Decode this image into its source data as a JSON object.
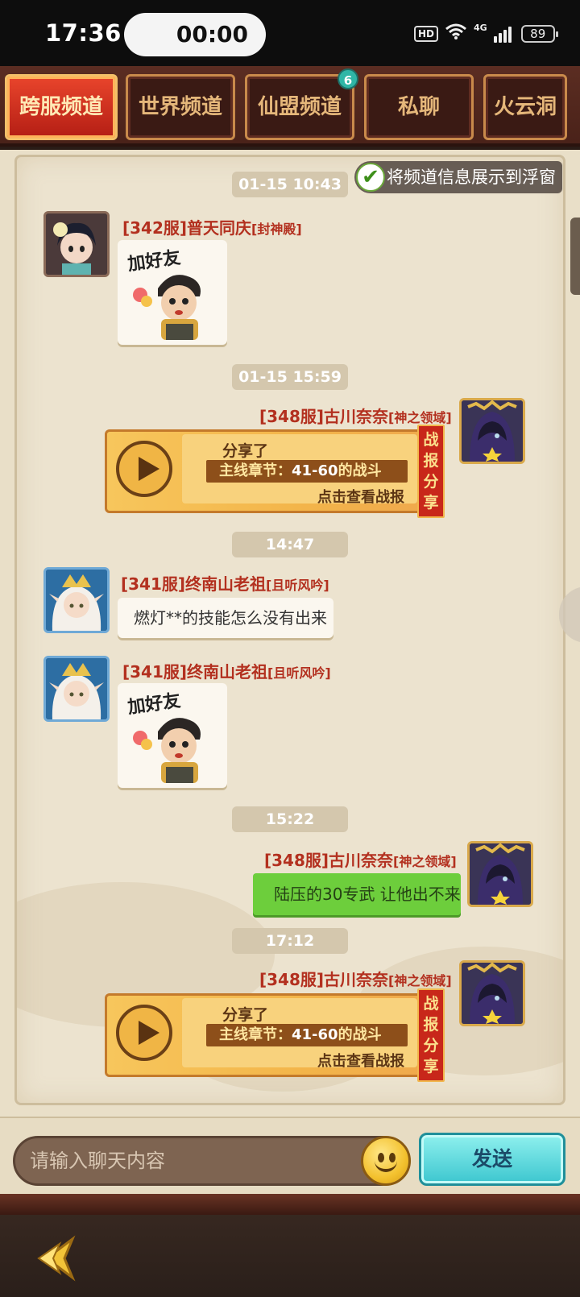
{
  "status_bar": {
    "time": "17:36",
    "recording_timer": "00:00",
    "hd_label": "HD",
    "network_label": "4G",
    "battery": "89"
  },
  "tabs": [
    {
      "label": "跨服频道",
      "active": true
    },
    {
      "label": "世界频道",
      "active": false
    },
    {
      "label": "仙盟频道",
      "active": false,
      "badge": "6"
    },
    {
      "label": "私聊",
      "active": false
    },
    {
      "label": "火云洞",
      "active": false
    }
  ],
  "float_toggle": {
    "label": "将频道信息展示到浮窗",
    "checked": true
  },
  "messages": {
    "t1": "01-15 10:43",
    "m1": {
      "server": "[342服]",
      "name": "普天同庆",
      "guild": "[封神殿]",
      "sticker": "加好友"
    },
    "t2": "01-15 15:59",
    "m2": {
      "server": "[348服]",
      "name": "古川奈奈",
      "guild": "[神之领域]",
      "shared": "分享了",
      "chapter_prefix": "主线章节：",
      "chapter_range": "41-60",
      "chapter_suffix": "的战斗",
      "view": "点击查看战报",
      "tag": "战报分享"
    },
    "t3": "14:47",
    "m3": {
      "server": "[341服]",
      "name": "终南山老祖",
      "guild": "[且听风吟]",
      "text": "燃灯**的技能怎么没有出来"
    },
    "m4": {
      "server": "[341服]",
      "name": "终南山老祖",
      "guild": "[且听风吟]",
      "sticker": "加好友"
    },
    "t4": "15:22",
    "m5": {
      "server": "[348服]",
      "name": "古川奈奈",
      "guild": "[神之领域]",
      "text": "陆压的30专武 让他出不来"
    },
    "t5": "17:12",
    "m6": {
      "server": "[348服]",
      "name": "古川奈奈",
      "guild": "[神之领域]",
      "shared": "分享了",
      "chapter_prefix": "主线章节：",
      "chapter_range": "41-60",
      "chapter_suffix": "的战斗",
      "view": "点击查看战报",
      "tag": "战报分享"
    }
  },
  "input": {
    "placeholder": "请输入聊天内容",
    "send_label": "发送"
  },
  "colors": {
    "name_red": "#b3301f",
    "green_bubble": "#6dce3c",
    "tab_active": "#d5321f",
    "send": "#3cc6cf"
  }
}
